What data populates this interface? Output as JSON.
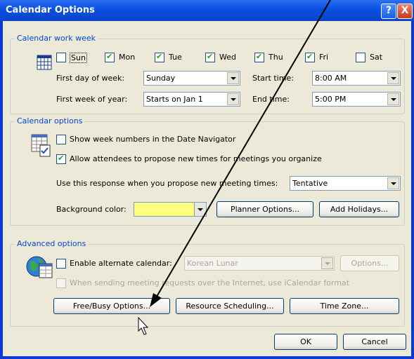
{
  "dialog": {
    "title": "Calendar Options",
    "help_label": "?",
    "close_label": "X"
  },
  "work_week": {
    "group_label": "Calendar work week",
    "days": [
      {
        "label": "Sun",
        "checked": false
      },
      {
        "label": "Mon",
        "checked": true
      },
      {
        "label": "Tue",
        "checked": true
      },
      {
        "label": "Wed",
        "checked": true
      },
      {
        "label": "Thu",
        "checked": true
      },
      {
        "label": "Fri",
        "checked": true
      },
      {
        "label": "Sat",
        "checked": false
      }
    ],
    "first_day_label": "First day of week:",
    "first_day_value": "Sunday",
    "start_time_label": "Start time:",
    "start_time_value": "8:00 AM",
    "first_week_label": "First week of year:",
    "first_week_value": "Starts on Jan 1",
    "end_time_label": "End time:",
    "end_time_value": "5:00 PM"
  },
  "calendar_options": {
    "group_label": "Calendar options",
    "show_week_numbers_label": "Show week numbers in the Date Navigator",
    "show_week_numbers_checked": false,
    "allow_propose_label": "Allow attendees to propose new times for meetings you organize",
    "allow_propose_checked": true,
    "response_label": "Use this response when you propose new meeting times:",
    "response_value": "Tentative",
    "background_color_label": "Background color:",
    "background_color_value": "#ffff80",
    "planner_options_label": "Planner Options...",
    "add_holidays_label": "Add Holidays..."
  },
  "advanced": {
    "group_label": "Advanced options",
    "alternate_calendar_label": "Enable alternate calendar:",
    "alternate_calendar_checked": false,
    "alternate_calendar_value": "Korean Lunar",
    "options_label": "Options...",
    "icalendar_label": "When sending meeting requests over the Internet, use iCalendar format",
    "freebusy_label": "Free/Busy Options...",
    "resource_label": "Resource Scheduling...",
    "timezone_label": "Time Zone..."
  },
  "footer": {
    "ok_label": "OK",
    "cancel_label": "Cancel"
  }
}
